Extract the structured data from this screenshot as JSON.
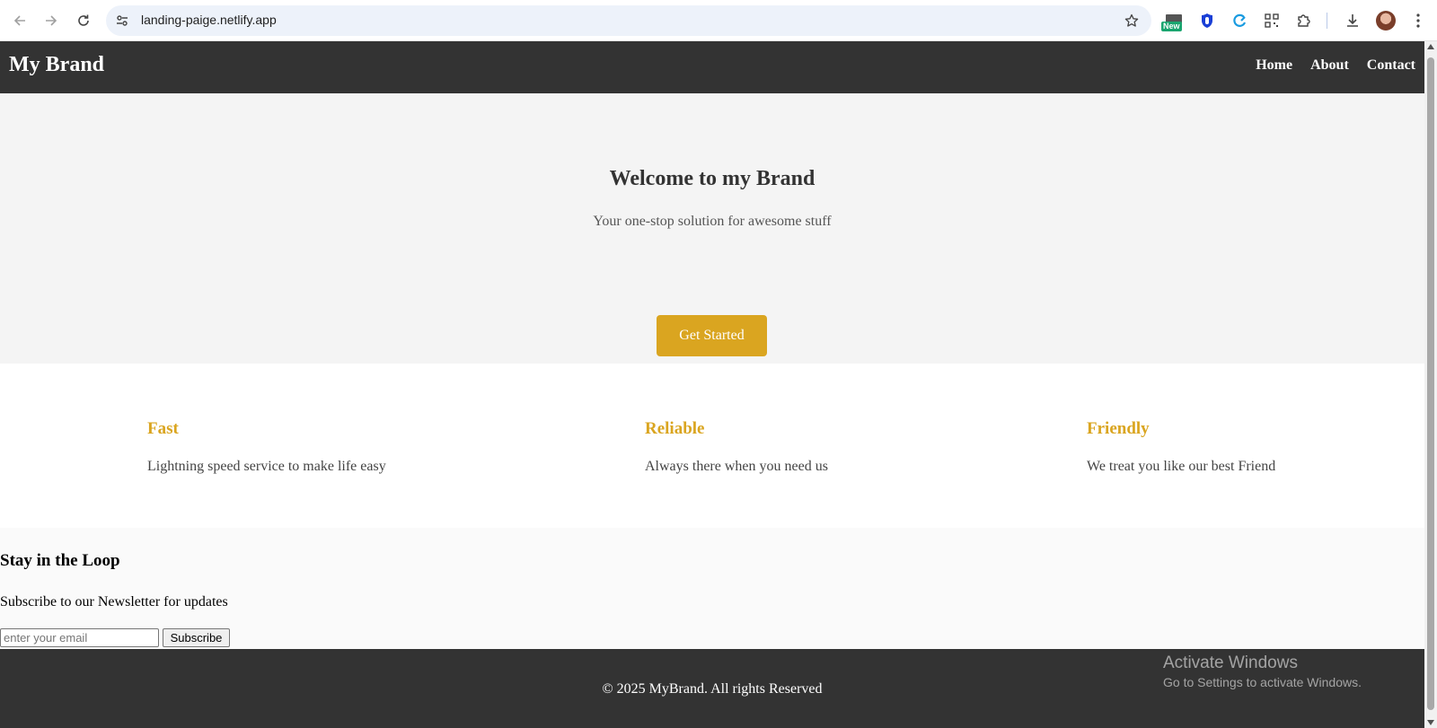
{
  "browser": {
    "url": "landing-paige.netlify.app",
    "extension_badge": "New"
  },
  "site": {
    "brand": "My Brand",
    "nav": [
      "Home",
      "About",
      "Contact"
    ],
    "accent_color": "#daa520",
    "header_color": "#333333"
  },
  "hero": {
    "title": "Welcome to my Brand",
    "subtitle": "Your one-stop solution for awesome stuff",
    "cta_label": "Get Started"
  },
  "features": [
    {
      "title": "Fast",
      "text": "Lightning speed service to make life easy"
    },
    {
      "title": "Reliable",
      "text": "Always there when you need us"
    },
    {
      "title": "Friendly",
      "text": "We treat you like our best Friend"
    }
  ],
  "newsletter": {
    "title": "Stay in the Loop",
    "text": "Subscribe to our Newsletter for updates",
    "placeholder": "enter your email",
    "button_label": "Subscribe"
  },
  "footer": {
    "text": "© 2025 MyBrand. All rights Reserved"
  },
  "os_watermark": {
    "line1": "Activate Windows",
    "line2": "Go to Settings to activate Windows."
  }
}
